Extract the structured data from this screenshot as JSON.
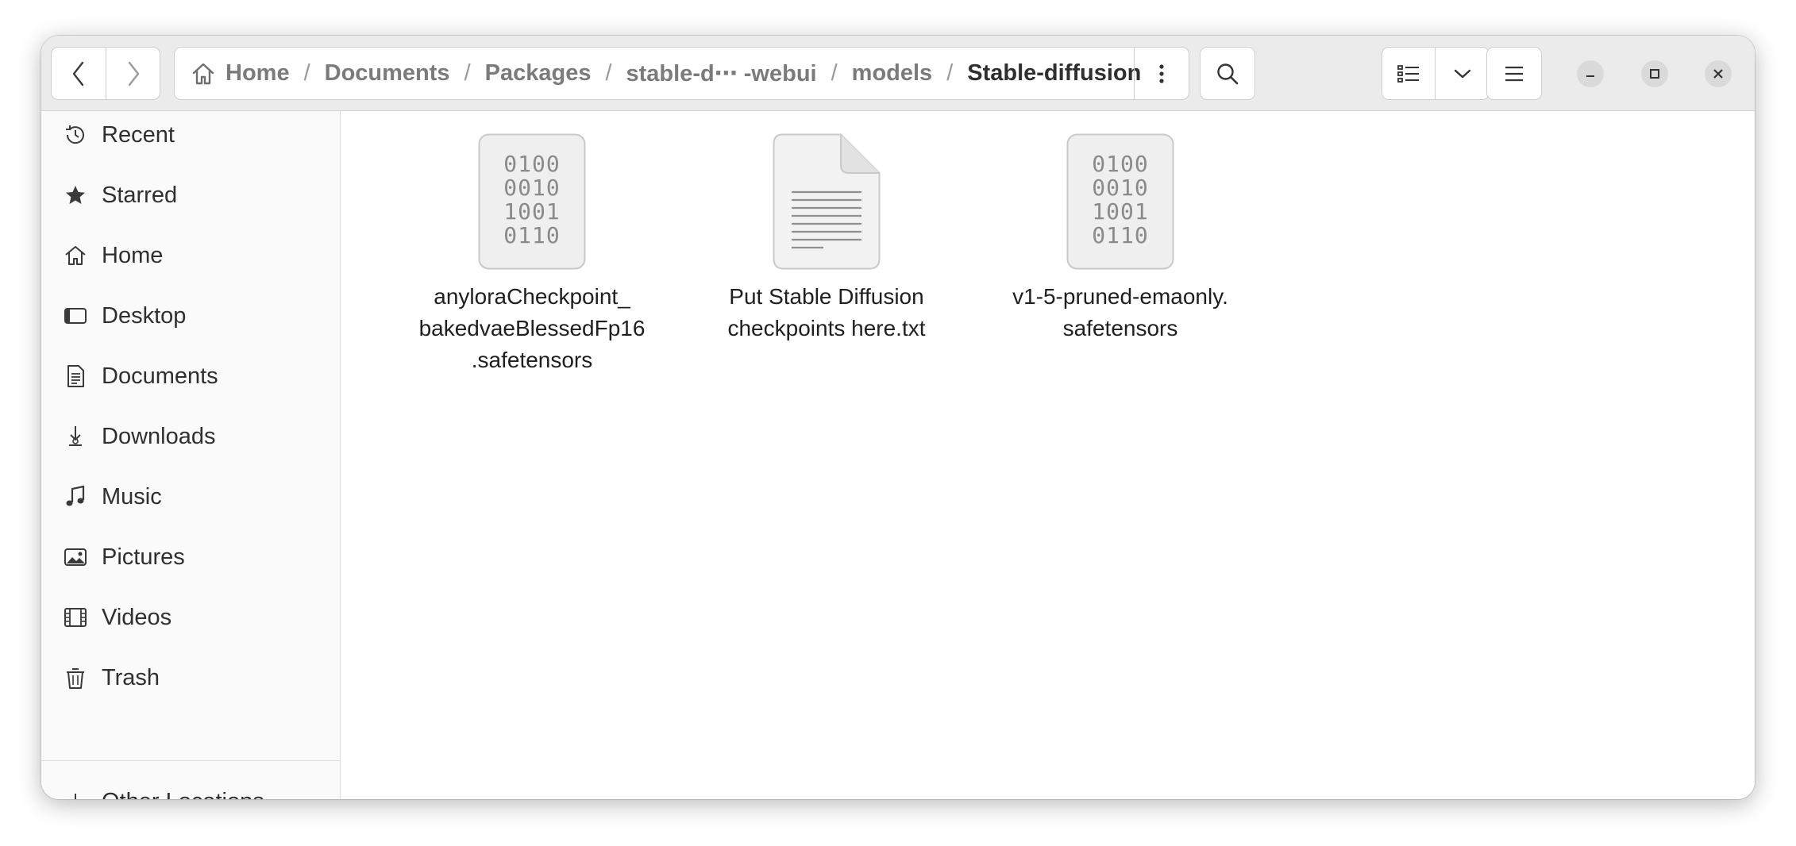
{
  "window": {
    "navigation": {
      "back_icon": "chevron-left-icon",
      "forward_icon": "chevron-right-icon"
    },
    "pathbar": {
      "home_icon": "home-icon",
      "crumbs": [
        "Home",
        "Documents",
        "Packages",
        "stable-d⋯ -webui",
        "models",
        "Stable-diffusion"
      ],
      "menu_icon": "vertical-dots-icon"
    },
    "toolbar": {
      "search_icon": "search-icon",
      "view_icon": "list-view-icon",
      "view_dropdown_icon": "chevron-down-icon",
      "menu_icon": "hamburger-menu-icon"
    },
    "controls": {
      "minimize_icon": "minimize-icon",
      "maximize_icon": "maximize-icon",
      "close_icon": "close-icon"
    }
  },
  "sidebar": {
    "items": [
      {
        "label": "Recent",
        "icon": "clock-icon"
      },
      {
        "label": "Starred",
        "icon": "star-icon"
      },
      {
        "label": "Home",
        "icon": "home-icon"
      },
      {
        "label": "Desktop",
        "icon": "desktop-icon"
      },
      {
        "label": "Documents",
        "icon": "document-icon"
      },
      {
        "label": "Downloads",
        "icon": "download-icon"
      },
      {
        "label": "Music",
        "icon": "music-note-icon"
      },
      {
        "label": "Pictures",
        "icon": "picture-icon"
      },
      {
        "label": "Videos",
        "icon": "film-icon"
      },
      {
        "label": "Trash",
        "icon": "trash-icon"
      }
    ],
    "other_locations": {
      "label": "Other Locations",
      "icon": "plus-icon"
    }
  },
  "files": [
    {
      "name": "anyloraCheckpoint_\nbakedvaeBlessedFp16\n.safetensors",
      "icon": "binary-file-icon",
      "binary_rows": [
        "0100",
        "0010",
        "1001",
        "0110"
      ]
    },
    {
      "name": "Put Stable Diffusion\ncheckpoints here.txt",
      "icon": "text-file-icon"
    },
    {
      "name": "v1-5-pruned-emaonly.\nsafetensors",
      "icon": "binary-file-icon",
      "binary_rows": [
        "0100",
        "0010",
        "1001",
        "0110"
      ]
    }
  ]
}
